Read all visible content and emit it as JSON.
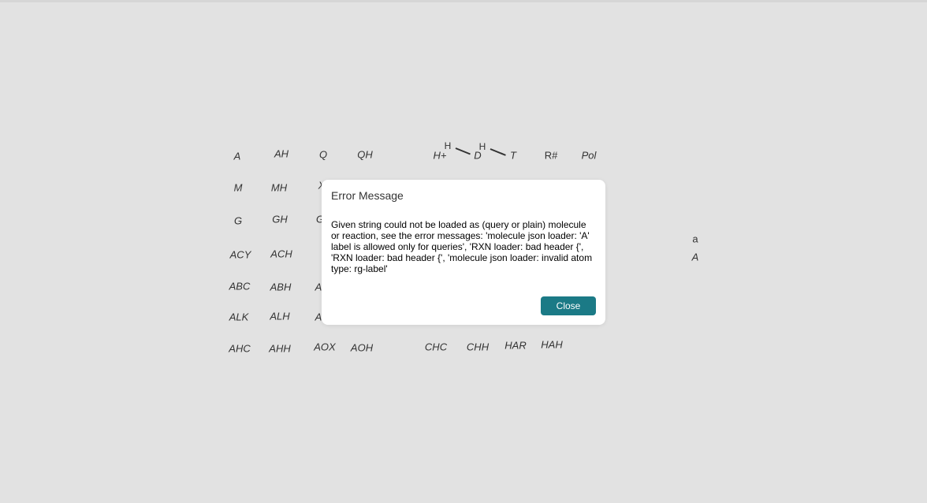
{
  "canvas_labels": [
    {
      "id": "A",
      "text": "A"
    },
    {
      "id": "AH",
      "text": "AH"
    },
    {
      "id": "Q",
      "text": "Q"
    },
    {
      "id": "QH",
      "text": "QH"
    },
    {
      "id": "Hplus",
      "text": "H+"
    },
    {
      "id": "D",
      "text": "D"
    },
    {
      "id": "T",
      "text": "T"
    },
    {
      "id": "Rsharp",
      "text": "R#"
    },
    {
      "id": "Pol",
      "text": "Pol"
    },
    {
      "id": "M",
      "text": "M"
    },
    {
      "id": "MH",
      "text": "MH"
    },
    {
      "id": "X_partial",
      "text": "X"
    },
    {
      "id": "G",
      "text": "G"
    },
    {
      "id": "GH",
      "text": "GH"
    },
    {
      "id": "G_partial",
      "text": "G"
    },
    {
      "id": "ACY",
      "text": "ACY"
    },
    {
      "id": "ACH",
      "text": "ACH"
    },
    {
      "id": "ABC",
      "text": "ABC"
    },
    {
      "id": "ABH",
      "text": "ABH"
    },
    {
      "id": "A_partial1",
      "text": "A"
    },
    {
      "id": "ALK",
      "text": "ALK"
    },
    {
      "id": "ALH",
      "text": "ALH"
    },
    {
      "id": "A_partial2",
      "text": "A"
    },
    {
      "id": "AHC",
      "text": "AHC"
    },
    {
      "id": "AHH",
      "text": "AHH"
    },
    {
      "id": "AOX",
      "text": "AOX"
    },
    {
      "id": "AOH",
      "text": "AOH"
    },
    {
      "id": "CHC",
      "text": "CHC"
    },
    {
      "id": "CHH",
      "text": "CHH"
    },
    {
      "id": "HAR",
      "text": "HAR"
    },
    {
      "id": "HAH",
      "text": "HAH"
    },
    {
      "id": "a_small",
      "text": "a"
    },
    {
      "id": "A_right",
      "text": "A"
    }
  ],
  "hydrogen_labels": [
    "H",
    "H"
  ],
  "dialog": {
    "title": "Error Message",
    "message": "Given string could not be loaded as (query or plain) molecule or reaction, see the error messages: 'molecule json loader: 'A' label is allowed only for queries', 'RXN loader: bad header {', 'RXN loader: bad header {', 'molecule json loader: invalid atom type: rg-label'",
    "close_label": "Close",
    "accent_color": "#1b7a86"
  }
}
